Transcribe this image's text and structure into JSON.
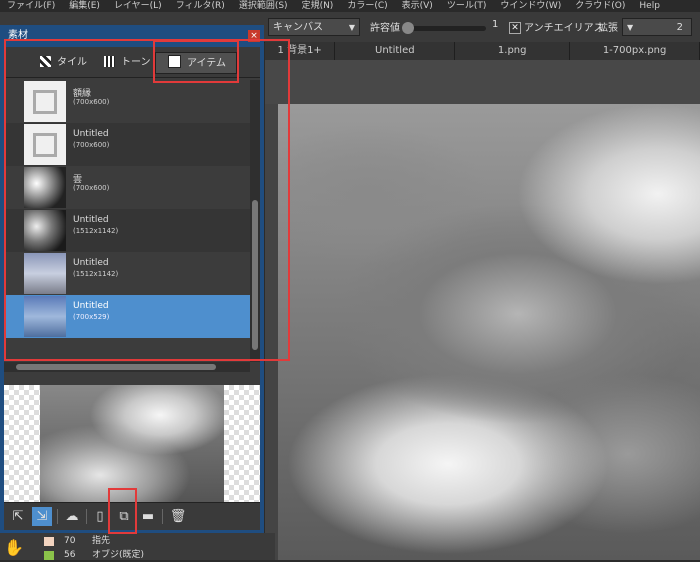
{
  "menu": [
    "ファイル(F)",
    "編集(E)",
    "レイヤー(L)",
    "フィルタ(R)",
    "選択範囲(S)",
    "定規(N)",
    "カラー(C)",
    "表示(V)",
    "ツール(T)",
    "ウインドウ(W)",
    "クラウド(O)",
    "Help"
  ],
  "options": {
    "target_dropdown": "キャンバス",
    "tolerance_label": "許容値",
    "tolerance_value": "1",
    "antialias_label": "アンチエイリアス",
    "expand_label": "拡張",
    "expand_value": "2"
  },
  "doc_tabs": [
    "1 背景1+",
    "Untitled",
    "1.png",
    "1-700px.png"
  ],
  "palette": {
    "title": "素材",
    "close": "×",
    "tabs": [
      {
        "label": "タイル",
        "icon": "tile-icon"
      },
      {
        "label": "トーン",
        "icon": "tone-icon"
      },
      {
        "label": "アイテム",
        "icon": "item-icon",
        "active": true
      }
    ],
    "items": [
      {
        "name": "額縁",
        "size": "(700x600)",
        "thumb": "frame"
      },
      {
        "name": "Untitled",
        "size": "(700x600)",
        "thumb": "frame"
      },
      {
        "name": "雲",
        "size": "(700x600)",
        "thumb": "cloud1"
      },
      {
        "name": "Untitled",
        "size": "(1512x1142)",
        "thumb": "cloud2"
      },
      {
        "name": "Untitled",
        "size": "(1512x1142)",
        "thumb": "sky1"
      },
      {
        "name": "Untitled",
        "size": "(700x529)",
        "thumb": "sky2",
        "selected": true
      }
    ],
    "toolbar_icons": [
      "paste-to-canvas-icon",
      "paste-as-layer-icon",
      "cloud-upload-icon",
      "new-item-icon",
      "add-from-file-icon",
      "folder-icon",
      "trash-icon"
    ]
  },
  "layers": [
    {
      "num": "70",
      "name": "指先",
      "color": "#f2d3bf"
    },
    {
      "num": "56",
      "name": "オブジ(既定)",
      "color": "#8bc34a"
    }
  ],
  "colors": {
    "palette_title_bg": "#1f4d80",
    "selection": "#4e8fce",
    "annotation": "#e23a3a",
    "close_button": "#c83a2c"
  }
}
